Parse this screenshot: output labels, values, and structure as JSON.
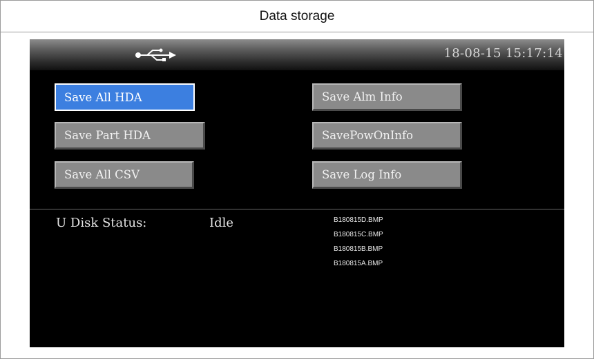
{
  "caption": "Data storage",
  "topbar": {
    "usb_icon": "usb-icon",
    "datetime": "18-08-15 15:17:14"
  },
  "buttons": {
    "save_all_hda": "Save All HDA",
    "save_part_hda": "Save Part HDA",
    "save_all_csv": "Save All CSV",
    "save_alm_info": "Save Alm Info",
    "save_pow_on_info": "SavePowOnInfo",
    "save_log_info": "Save Log Info"
  },
  "status": {
    "label": "U Disk Status:",
    "value": "Idle"
  },
  "files": [
    "B180815D.BMP",
    "B180815C.BMP",
    "B180815B.BMP",
    "B180815A.BMP"
  ],
  "colors": {
    "selected_button": "#3c7fe0",
    "button": "#8a8a8a",
    "screen_bg": "#000000"
  }
}
